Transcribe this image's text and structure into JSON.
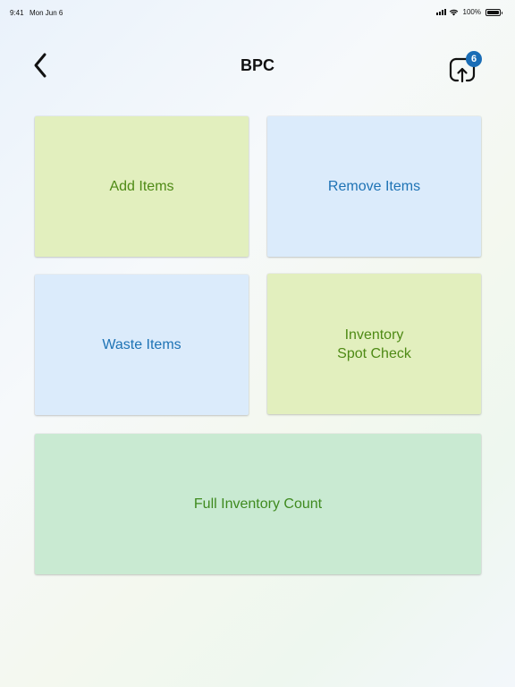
{
  "status_bar": {
    "time": "9:41",
    "date": "Mon Jun 6",
    "battery": "100%"
  },
  "header": {
    "title": "BPC",
    "back_icon": "chevron-left-icon",
    "sync_icon": "upload-box-icon",
    "sync_badge_count": "6"
  },
  "tiles": [
    {
      "id": "add",
      "label": "Add Items",
      "color": "#e2efbe",
      "text_color": "#4e8a15"
    },
    {
      "id": "remove",
      "label": "Remove Items",
      "color": "#dbebfb",
      "text_color": "#1e73b5"
    },
    {
      "id": "waste",
      "label": "Waste Items",
      "color": "#dbebfb",
      "text_color": "#1e73b5"
    },
    {
      "id": "spot",
      "label": "Inventory\nSpot Check",
      "color": "#e2efbe",
      "text_color": "#4e8a15"
    },
    {
      "id": "full",
      "label": "Full Inventory Count",
      "color": "#c9ead2",
      "text_color": "#3f8a1f"
    }
  ],
  "colors": {
    "badge": "#1a6db6"
  }
}
